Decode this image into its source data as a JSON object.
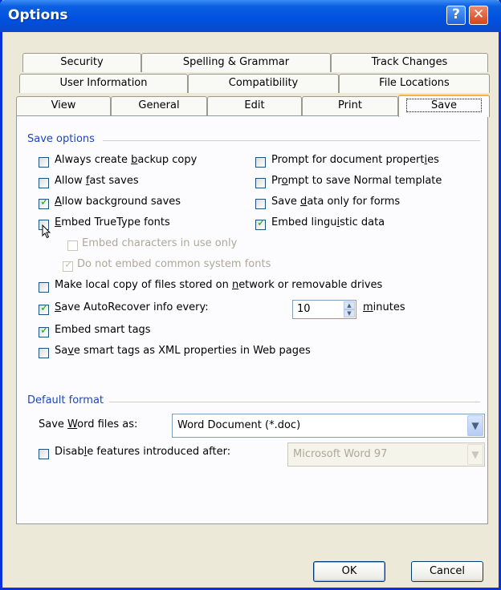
{
  "window": {
    "title": "Options"
  },
  "tabs": {
    "row1": [
      "Security",
      "Spelling & Grammar",
      "Track Changes"
    ],
    "row2": [
      "User Information",
      "Compatibility",
      "File Locations"
    ],
    "row3": [
      "View",
      "General",
      "Edit",
      "Print",
      "Save"
    ],
    "active": "Save"
  },
  "save_options": {
    "heading": "Save options",
    "always_backup": {
      "label": "Always create backup copy",
      "checked": false
    },
    "fast_saves": {
      "label": "Allow fast saves",
      "checked": false
    },
    "background_saves": {
      "label": "Allow background saves",
      "checked": true
    },
    "embed_truetype": {
      "label": "Embed TrueType fonts",
      "checked": false
    },
    "embed_chars_in_use": {
      "label": "Embed characters in use only",
      "checked": false
    },
    "no_common_fonts": {
      "label": "Do not embed common system fonts",
      "checked": true
    },
    "prompt_properties": {
      "label": "Prompt for document properties",
      "checked": false
    },
    "prompt_normal": {
      "label": "Prompt to save Normal template",
      "checked": false
    },
    "save_data_forms": {
      "label": "Save data only for forms",
      "checked": false
    },
    "embed_linguistic": {
      "label": "Embed linguistic data",
      "checked": true
    },
    "local_copy": {
      "label": "Make local copy of files stored on network or removable drives",
      "checked": false
    },
    "autorecover": {
      "label": "Save AutoRecover info every:",
      "checked": true,
      "value": "10",
      "unit": "minutes"
    },
    "smart_tags": {
      "label": "Embed smart tags",
      "checked": true
    },
    "smart_tags_xml": {
      "label": "Save smart tags as XML properties in Web pages",
      "checked": false
    }
  },
  "default_format": {
    "heading": "Default format",
    "save_as_label": "Save Word files as:",
    "save_as_value": "Word Document (*.doc)",
    "disable_features": {
      "label": "Disable features introduced after:",
      "checked": false,
      "value": "Microsoft Word 97"
    }
  },
  "buttons": {
    "ok": "OK",
    "cancel": "Cancel"
  }
}
